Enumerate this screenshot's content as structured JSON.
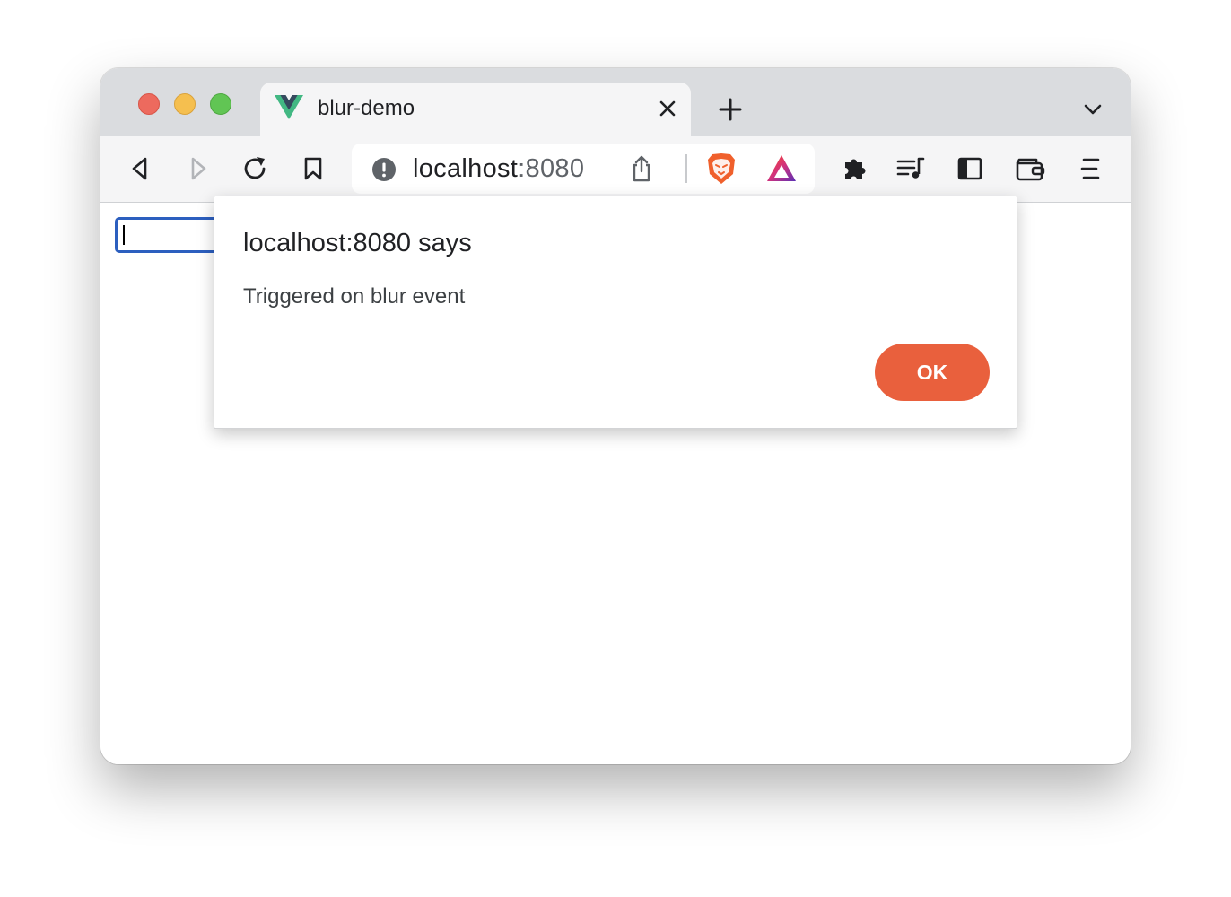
{
  "browser": {
    "tab": {
      "title": "blur-demo",
      "favicon": "vue-logo-icon"
    },
    "toolbar": {
      "url_host": "localhost",
      "url_port": ":8080",
      "icons": [
        "back-icon",
        "forward-icon",
        "reload-icon",
        "bookmark-icon",
        "site-info-icon",
        "share-icon",
        "brave-shields-icon",
        "brave-rewards-icon",
        "extensions-icon",
        "media-controls-icon",
        "sidebar-icon",
        "wallet-icon",
        "menu-icon"
      ]
    },
    "colors": {
      "tabstrip": "#dadcdf",
      "toolbar": "#f5f5f6",
      "accent_ok": "#e9603d",
      "focus_ring": "#2c5fbf"
    }
  },
  "page": {
    "input_value": ""
  },
  "dialog": {
    "title": "localhost:8080 says",
    "message": "Triggered on blur event",
    "ok_label": "OK"
  }
}
